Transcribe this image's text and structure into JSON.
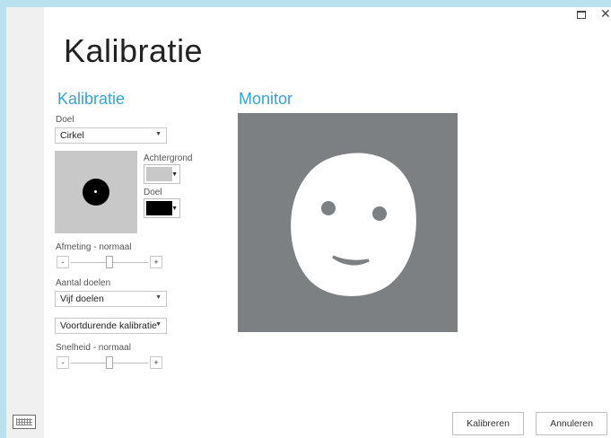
{
  "window": {
    "maximize_icon": "maximize-icon",
    "close_icon": "close-icon",
    "close_glyph": "✕"
  },
  "page": {
    "title": "Kalibratie"
  },
  "calibration": {
    "heading": "Kalibratie",
    "target": {
      "label": "Doel",
      "value": "Cirkel"
    },
    "background_color": {
      "label": "Achtergrond",
      "color": "#c8c8c8"
    },
    "target_color": {
      "label": "Doel",
      "color": "#000000"
    },
    "size": {
      "label": "Afmeting - normaal",
      "minus": "-",
      "plus": "+",
      "level": 0.5
    },
    "target_count": {
      "label": "Aantal doelen",
      "value": "Vijf doelen"
    },
    "mode": {
      "value": "Voortdurende kalibratie"
    },
    "speed": {
      "label": "Snelheid - normaal",
      "minus": "-",
      "plus": "+",
      "level": 0.5
    }
  },
  "monitor": {
    "heading": "Monitor",
    "background_color": "#7d8083"
  },
  "buttons": {
    "calibrate": "Kalibreren",
    "cancel": "Annuleren"
  },
  "icons": {
    "keyboard": "keyboard-icon",
    "dropdown": "chevron-down-icon"
  },
  "colors": {
    "accent": "#3aa3d4",
    "frame": "#b9e1ee"
  }
}
